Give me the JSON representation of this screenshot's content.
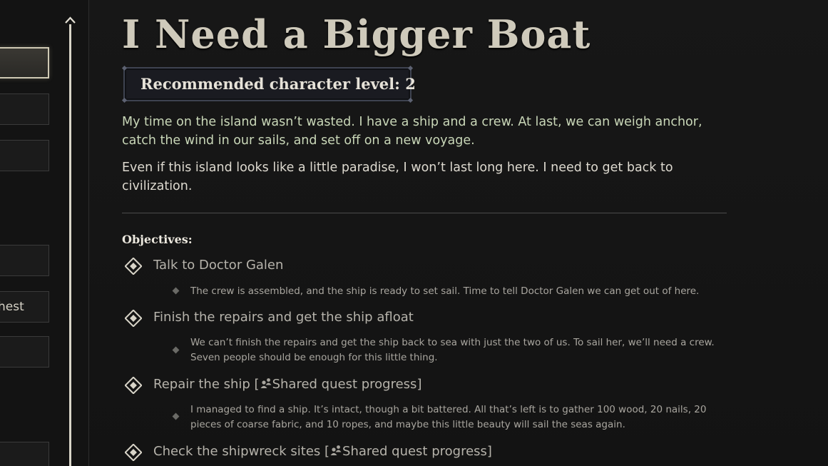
{
  "quest_list": {
    "visible_tab_text": "hest"
  },
  "quest": {
    "title": "I Need a Bigger Boat",
    "level_label": "Recommended character level: 2",
    "description_1": "My time on the island wasn’t wasted. I have a ship and a crew. At last, we can weigh anchor, catch the wind in our sails, and set off on a new voyage.",
    "description_2": "Even if this island looks like a little paradise, I won’t last long here. I need to get back to civilization.",
    "objectives_heading": "Objectives:",
    "objectives": [
      {
        "title": "Talk to Doctor Galen",
        "shared": "",
        "desc": "The crew is assembled, and the ship is ready to set sail. Time to tell Doctor Galen we can get out of here."
      },
      {
        "title": "Finish the repairs and get the ship afloat",
        "shared": "",
        "desc": "We can’t finish the repairs and get the ship back to sea with just the two of us. To sail her, we’ll need a crew. Seven people should be enough for this little thing."
      },
      {
        "title": "Repair the ship [",
        "shared": "Shared quest progress]",
        "desc": "I managed to find a ship. It’s intact, though a bit battered. All that’s left is to gather 100 wood, 20 nails, 20 pieces of coarse fabric, and 10 ropes, and maybe this little beauty will sail the seas again."
      },
      {
        "title": "Check the shipwreck sites [",
        "shared": "Shared quest progress]",
        "desc": ""
      }
    ]
  },
  "icons": {
    "objective": "diamond-objective-icon",
    "shared": "shared-progress-icon",
    "scroll": "scroll-up-arrow-icon"
  },
  "colors": {
    "background": "#141414",
    "title": "#cfcabb",
    "description_green": "#c9d7b8",
    "objective_text": "#b6b3ab"
  }
}
